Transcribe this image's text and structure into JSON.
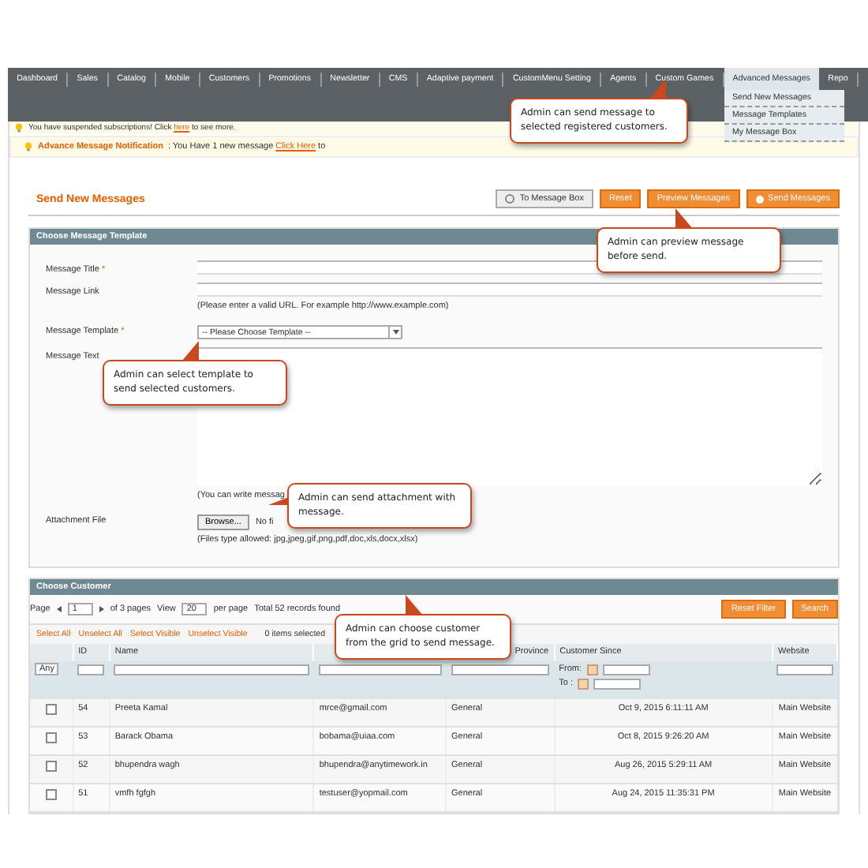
{
  "nav": {
    "items": [
      {
        "label": "Dashboard",
        "selected": false
      },
      {
        "label": "Sales",
        "selected": false
      },
      {
        "label": "Catalog",
        "selected": false
      },
      {
        "label": "Mobile",
        "selected": false
      },
      {
        "label": "Customers",
        "selected": false
      },
      {
        "label": "Promotions",
        "selected": false
      },
      {
        "label": "Newsletter",
        "selected": false
      },
      {
        "label": "CMS",
        "selected": false
      },
      {
        "label": "Adaptive payment",
        "selected": false
      },
      {
        "label": "CustomMenu Setting",
        "selected": false
      },
      {
        "label": "Agents",
        "selected": false
      },
      {
        "label": "Custom Games",
        "selected": false
      },
      {
        "label": "Advanced Messages",
        "selected": true
      },
      {
        "label": "Repo",
        "selected": false
      }
    ],
    "dropdown": [
      "Send New Messages",
      "Message Templates",
      "My Message Box"
    ]
  },
  "notices": [
    {
      "kind": "system",
      "before": "You have suspended subscriptions! Click ",
      "link": "here",
      "after": " to see more."
    },
    {
      "kind": "message",
      "title": "Advance Message Notification",
      "before": " : You Have  1  new message ",
      "link": "Click Here",
      "after": " to"
    }
  ],
  "page": {
    "title": "Send New Messages",
    "buttons": [
      {
        "label": "To Message Box",
        "kind": "back"
      },
      {
        "label": "Reset",
        "kind": "plain"
      },
      {
        "label": "Preview Messages",
        "kind": "plain"
      },
      {
        "label": "Send Messages",
        "kind": "send"
      }
    ]
  },
  "template_section": {
    "title": "Choose Message Template",
    "fields": [
      {
        "kind": "text",
        "label": "Message Title",
        "required_mark": "*"
      },
      {
        "kind": "text",
        "label": "Message Link",
        "hint": "(Please enter a valid URL. For example http://www.example.com)"
      },
      {
        "kind": "select",
        "label": "Message Template",
        "required_mark": "*",
        "value": "-- Please Choose Template --"
      },
      {
        "kind": "textarea",
        "label": "Message Text",
        "hint": "(You can write messag"
      },
      {
        "kind": "file",
        "label": "Attachment File",
        "button": "Browse...",
        "value": "No fi",
        "hint": "(Files type allowed: jpg,jpeg,gif,png,pdf,doc,xls,docx,xlsx)"
      }
    ]
  },
  "customer_section": {
    "title": "Choose Customer",
    "pager": {
      "page_label": "Page",
      "page": "1",
      "pages": "of 3 pages",
      "view_label": "View",
      "per_page": "20",
      "per_page_label": "per page",
      "total": "Total 52 records found"
    },
    "buttons": [
      "Reset Filter",
      "Search"
    ],
    "mass_actions": [
      "Select All",
      "Unselect All",
      "Select Visible",
      "Unselect Visible"
    ],
    "selected_count": "0 items selected",
    "columns": [
      {},
      {
        "label": "ID"
      },
      {
        "label": "Name"
      },
      {},
      {
        "label": "Province"
      },
      {
        "label": "Customer Since"
      },
      {
        "label": "Website"
      }
    ],
    "filters": {
      "any": "Any",
      "from": "From:",
      "to": "To :"
    },
    "rows": [
      {
        "checked": false,
        "id": "54",
        "name": "Preeta Kamal",
        "email": "mrce@gmail.com",
        "group": "General",
        "since": "Oct 9, 2015 6:11:11 AM",
        "website": "Main Website"
      },
      {
        "checked": false,
        "id": "53",
        "name": "Barack Obama",
        "email": "bobama@uiaa.com",
        "group": "General",
        "since": "Oct 8, 2015 9:26:20 AM",
        "website": "Main Website"
      },
      {
        "checked": false,
        "id": "52",
        "name": "bhupendra wagh",
        "email": "bhupendra@anytimework.in",
        "group": "General",
        "since": "Aug 26, 2015 5:29:11 AM",
        "website": "Main Website"
      },
      {
        "checked": false,
        "id": "51",
        "name": "vmfh fgfgh",
        "email": "testuser@yopmail.com",
        "group": "General",
        "since": "Aug 24, 2015 11:35:31 PM",
        "website": "Main Website"
      }
    ]
  },
  "callouts": [
    {
      "text": "Admin can send message to selected registered customers."
    },
    {
      "text": "Admin can preview message before send."
    },
    {
      "text": "Admin can select template to send selected customers."
    },
    {
      "text": "Admin can send attachment with message."
    },
    {
      "text": "Admin can choose customer from the grid to send message."
    }
  ]
}
